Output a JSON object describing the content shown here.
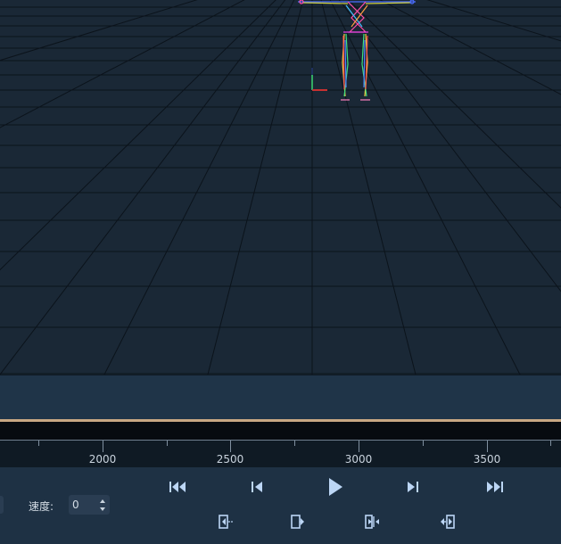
{
  "timeline": {
    "ruler_labels": [
      "2000",
      "2500",
      "3000",
      "3500"
    ]
  },
  "controls": {
    "speed_label": "速度:",
    "speed_value": "0"
  },
  "icons": {
    "playback": [
      "skip-to-start-icon",
      "step-back-icon",
      "play-icon",
      "step-forward-icon",
      "skip-to-end-icon"
    ],
    "range": [
      "set-in-point-icon",
      "set-out-point-icon",
      "shrink-range-icon",
      "expand-range-icon"
    ]
  },
  "colors": {
    "accent_icon": "#bcd6f5",
    "scrub_line": "#c8a783",
    "viewport_bg": "#1a2836"
  }
}
